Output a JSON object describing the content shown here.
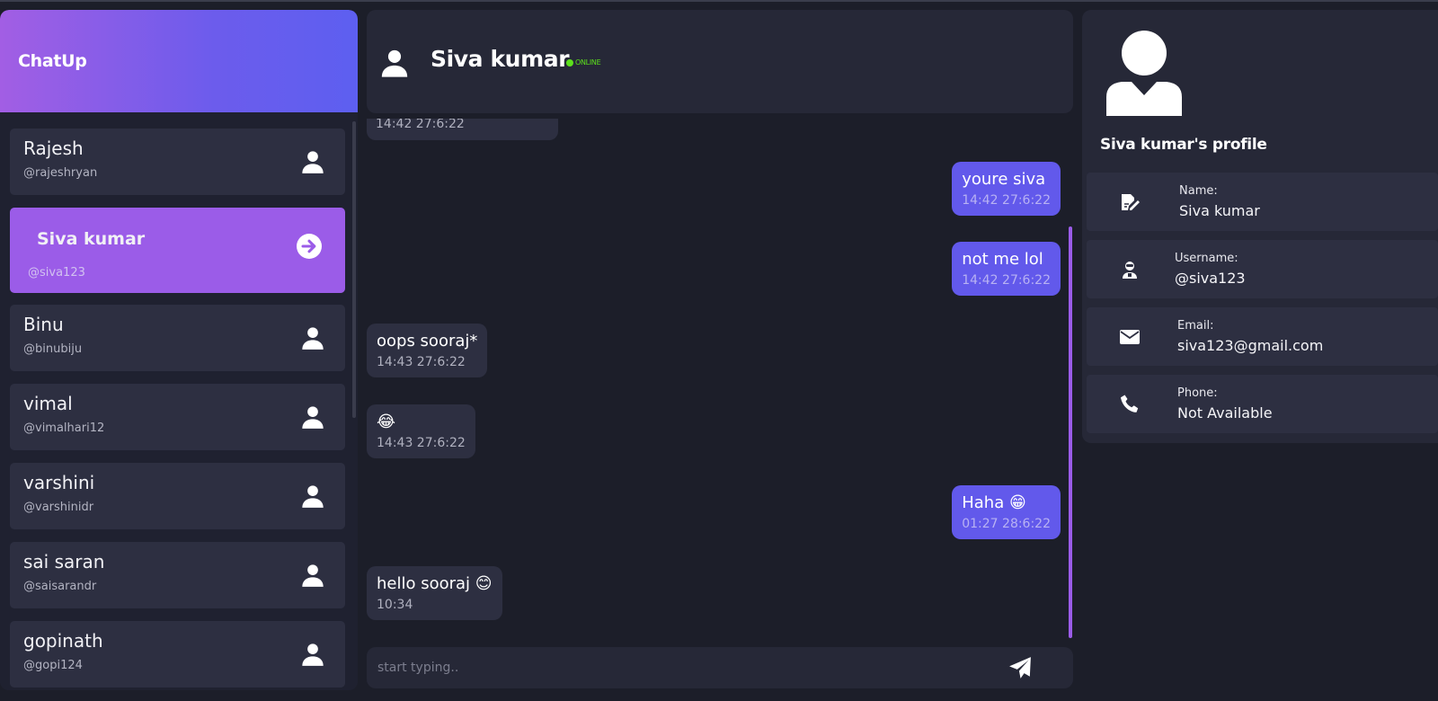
{
  "app": {
    "name": "ChatUp"
  },
  "contacts": [
    {
      "name": "Rajesh",
      "handle": "@rajeshryan",
      "active": false
    },
    {
      "name": "Siva kumar",
      "handle": "@siva123",
      "active": true
    },
    {
      "name": "Binu",
      "handle": "@binubiju",
      "active": false
    },
    {
      "name": "vimal",
      "handle": "@vimalhari12",
      "active": false
    },
    {
      "name": "varshini",
      "handle": "@varshinidr",
      "active": false
    },
    {
      "name": "sai saran",
      "handle": "@saisarandr",
      "active": false
    },
    {
      "name": "gopinath",
      "handle": "@gopi124",
      "active": false
    }
  ],
  "chat": {
    "header_name": "Siva kumar",
    "status": "ONLINE",
    "messages": [
      {
        "direction": "in",
        "text": "",
        "time": "14:42 27:6:22",
        "partial": true
      },
      {
        "direction": "out",
        "text": "youre siva",
        "time": "14:42 27:6:22"
      },
      {
        "direction": "out",
        "text": "not me lol",
        "time": "14:42 27:6:22"
      },
      {
        "direction": "in",
        "text": "oops sooraj*",
        "time": "14:43 27:6:22"
      },
      {
        "direction": "in",
        "text": "😂",
        "time": "14:43 27:6:22"
      },
      {
        "direction": "out",
        "text": "Haha 😁",
        "time": "01:27 28:6:22"
      },
      {
        "direction": "in",
        "text": "hello sooraj 😊",
        "time": "10:34"
      }
    ],
    "composer_placeholder": "start typing.."
  },
  "profile": {
    "title": "Siva kumar's profile",
    "fields": [
      {
        "label": "Name:",
        "value": "Siva kumar",
        "icon": "edit-document-icon"
      },
      {
        "label": "Username:",
        "value": "@siva123",
        "icon": "user-badge-icon"
      },
      {
        "label": "Email:",
        "value": "siva123@gmail.com",
        "icon": "envelope-icon"
      },
      {
        "label": "Phone:",
        "value": "Not Available",
        "icon": "phone-icon"
      }
    ]
  },
  "colors": {
    "background": "#1c1e29",
    "panel": "#262837",
    "card": "#2d2f41",
    "accent_purple": "#9b5ce8",
    "outgoing_bubble": "#6259eb",
    "online": "#5ce01c"
  }
}
